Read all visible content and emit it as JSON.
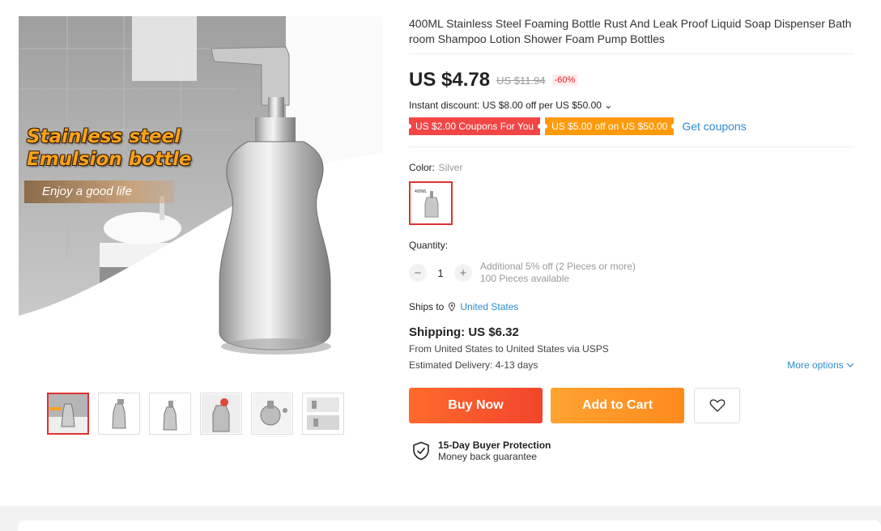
{
  "gallery": {
    "overlay_title": "Stainless steel\nEmulsion bottle",
    "overlay_banner": "Enjoy a good life",
    "thumb_count": 6
  },
  "product": {
    "title": "400ML Stainless Steel Foaming Bottle Rust And Leak Proof Liquid Soap Dispenser Bathroom Shampoo Lotion Shower Foam Pump Bottles",
    "price": "US $4.78",
    "old_price": "US $11.94",
    "discount": "-60%",
    "instant_discount": "Instant discount: US $8.00 off per US $50.00 ⌄",
    "coupons": [
      "US $2.00 Coupons For You",
      "US $5.00 off on US $50.00"
    ],
    "get_coupons": "Get coupons"
  },
  "color": {
    "label": "Color:",
    "value": "Silver",
    "swatch_text": "400ML"
  },
  "quantity": {
    "label": "Quantity:",
    "minus": "−",
    "value": "1",
    "plus": "+",
    "note1": "Additional 5% off (2 Pieces or more)",
    "note2": "100 Pieces available"
  },
  "shipping": {
    "ships_to_label": "Ships to",
    "ships_to_value": "United States",
    "title": "Shipping: US $6.32",
    "from_text": "From United States to United States via USPS",
    "delivery": "Estimated Delivery: 4-13 days",
    "more_options": "More options"
  },
  "actions": {
    "buy_now": "Buy Now",
    "add_to_cart": "Add to Cart"
  },
  "protection": {
    "title": "15-Day Buyer Protection",
    "subtitle": "Money back guarantee"
  },
  "colors": {
    "accent_red": "#e03131",
    "price_text": "#222222",
    "link": "#2e8bcc"
  }
}
